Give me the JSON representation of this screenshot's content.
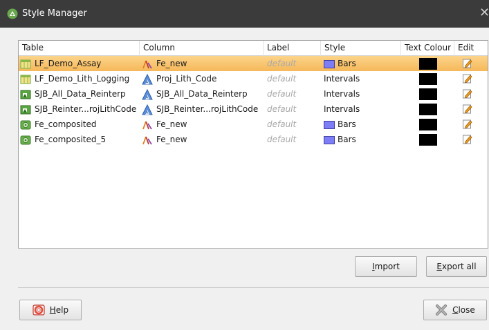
{
  "window": {
    "title": "Style Manager"
  },
  "table": {
    "headers": {
      "table": "Table",
      "column": "Column",
      "label": "Label",
      "style": "Style",
      "text_colour": "Text Colour",
      "edit": "Edit"
    },
    "rows": [
      {
        "table": "LF_Demo_Assay",
        "table_icon": "interval-table-icon",
        "column": "Fe_new",
        "column_icon": "numeric-column-icon",
        "label": "default",
        "style": "Bars",
        "style_swatch": "#7d7df5",
        "text_colour": "#000000",
        "selected": true
      },
      {
        "table": "LF_Demo_Lith_Logging",
        "table_icon": "interval-table-icon",
        "column": "Proj_Lith_Code",
        "column_icon": "category-column-icon",
        "label": "default",
        "style": "Intervals",
        "style_swatch": "",
        "text_colour": "#000000",
        "selected": false
      },
      {
        "table": "SJB_All_Data_Reinterp",
        "table_icon": "interpretation-table-icon",
        "column": "SJB_All_Data_Reinterp",
        "column_icon": "category-column-icon",
        "label": "default",
        "style": "Intervals",
        "style_swatch": "",
        "text_colour": "#000000",
        "selected": false
      },
      {
        "table": "SJB_Reinter...rojLithCode",
        "table_icon": "interpretation-table-icon",
        "column": "SJB_Reinter...rojLithCode",
        "column_icon": "category-column-icon",
        "label": "default",
        "style": "Intervals",
        "style_swatch": "",
        "text_colour": "#000000",
        "selected": false
      },
      {
        "table": "Fe_composited",
        "table_icon": "composite-table-icon",
        "column": "Fe_new",
        "column_icon": "numeric-column-icon",
        "label": "default",
        "style": "Bars",
        "style_swatch": "#7d7df5",
        "text_colour": "#000000",
        "selected": false
      },
      {
        "table": "Fe_composited_5",
        "table_icon": "composite-table-icon",
        "column": "Fe_new",
        "column_icon": "numeric-column-icon",
        "label": "default",
        "style": "Bars",
        "style_swatch": "#7d7df5",
        "text_colour": "#000000",
        "selected": false
      }
    ]
  },
  "buttons": {
    "import": "Import",
    "export_all": "Export all",
    "help": "Help",
    "close": "Close"
  },
  "colors": {
    "titlebar": "#3b3b3b",
    "selected_row": "#f6b85a",
    "bars_swatch": "#7d7df5"
  }
}
